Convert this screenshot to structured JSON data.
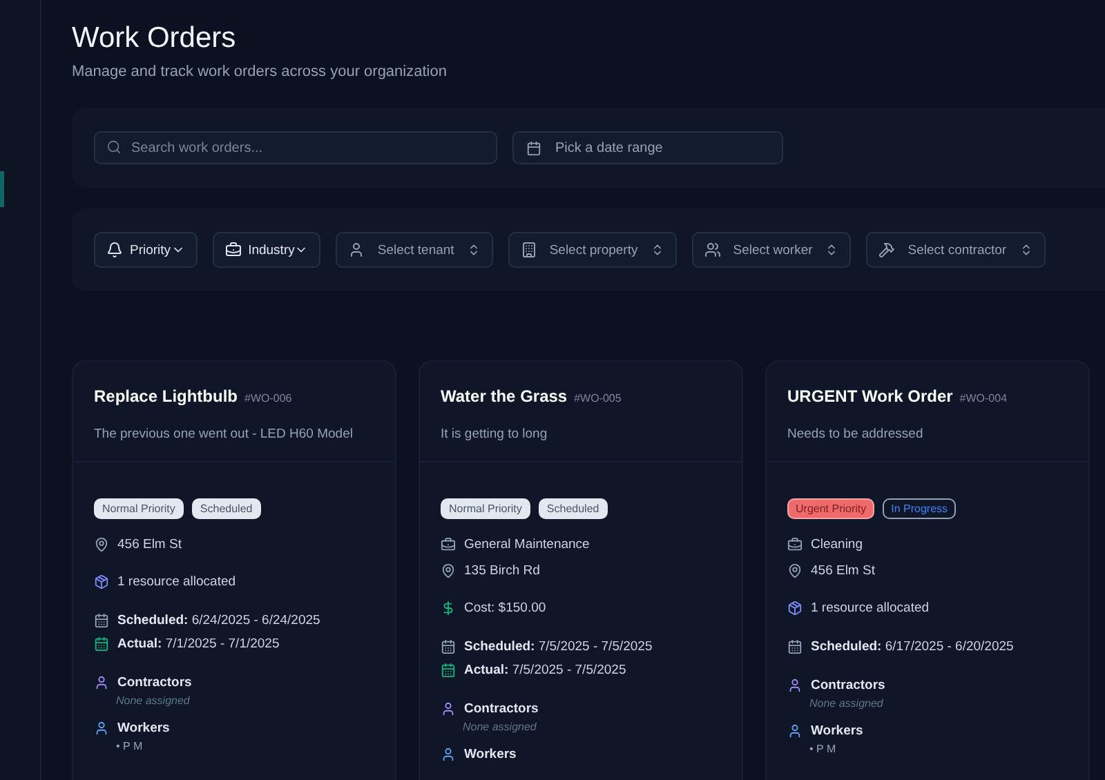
{
  "header": {
    "title": "Work Orders",
    "subtitle": "Manage and track work orders across your organization"
  },
  "search": {
    "placeholder": "Search work orders...",
    "date_placeholder": "Pick a date range"
  },
  "filters": [
    {
      "kind": "menu",
      "label": "Priority"
    },
    {
      "kind": "menu",
      "label": "Industry"
    },
    {
      "kind": "select",
      "label": "Select tenant"
    },
    {
      "kind": "select",
      "label": "Select property"
    },
    {
      "kind": "select",
      "label": "Select worker"
    },
    {
      "kind": "select",
      "label": "Select contractor"
    }
  ],
  "work_orders": [
    {
      "title": "Replace Lightbulb",
      "code": "#WO-006",
      "description": "The previous one went out - LED H60 Model",
      "badges": [
        {
          "kind": "normal",
          "label": "Normal Priority"
        },
        {
          "kind": "scheduled",
          "label": "Scheduled"
        }
      ],
      "details": [
        {
          "kind": "location",
          "text": "456 Elm St"
        },
        {
          "kind": "resources",
          "text": "1 resource allocated"
        }
      ],
      "dates": [
        {
          "kind": "scheduled",
          "label": "Scheduled:",
          "value": "6/24/2025 - 6/24/2025"
        },
        {
          "kind": "actual",
          "label": "Actual:",
          "value": "7/1/2025 - 7/1/2025"
        }
      ],
      "contractors": {
        "label": "Contractors",
        "empty": "None assigned"
      },
      "workers": {
        "label": "Workers",
        "items": [
          "• P M"
        ]
      }
    },
    {
      "title": "Water the Grass",
      "code": "#WO-005",
      "description": "It is getting to long",
      "badges": [
        {
          "kind": "normal",
          "label": "Normal Priority"
        },
        {
          "kind": "scheduled",
          "label": "Scheduled"
        }
      ],
      "details": [
        {
          "kind": "industry",
          "text": "General Maintenance"
        },
        {
          "kind": "location",
          "text": "135 Birch Rd"
        },
        {
          "kind": "cost",
          "text": "Cost: $150.00"
        }
      ],
      "dates": [
        {
          "kind": "scheduled",
          "label": "Scheduled:",
          "value": "7/5/2025 - 7/5/2025"
        },
        {
          "kind": "actual",
          "label": "Actual:",
          "value": "7/5/2025 - 7/5/2025"
        }
      ],
      "contractors": {
        "label": "Contractors",
        "empty": "None assigned"
      },
      "workers": {
        "label": "Workers"
      }
    },
    {
      "title": "URGENT Work Order",
      "code": "#WO-004",
      "description": "Needs to be addressed",
      "badges": [
        {
          "kind": "urgent",
          "label": "Urgent Priority"
        },
        {
          "kind": "in_progress",
          "label": "In Progress"
        }
      ],
      "details": [
        {
          "kind": "industry",
          "text": "Cleaning"
        },
        {
          "kind": "location",
          "text": "456 Elm St"
        },
        {
          "kind": "resources",
          "text": "1 resource allocated"
        }
      ],
      "dates": [
        {
          "kind": "scheduled",
          "label": "Scheduled:",
          "value": "6/17/2025 - 6/20/2025"
        }
      ],
      "contractors": {
        "label": "Contractors",
        "empty": "None assigned"
      },
      "workers": {
        "label": "Workers",
        "items": [
          "• P M"
        ]
      }
    }
  ]
}
